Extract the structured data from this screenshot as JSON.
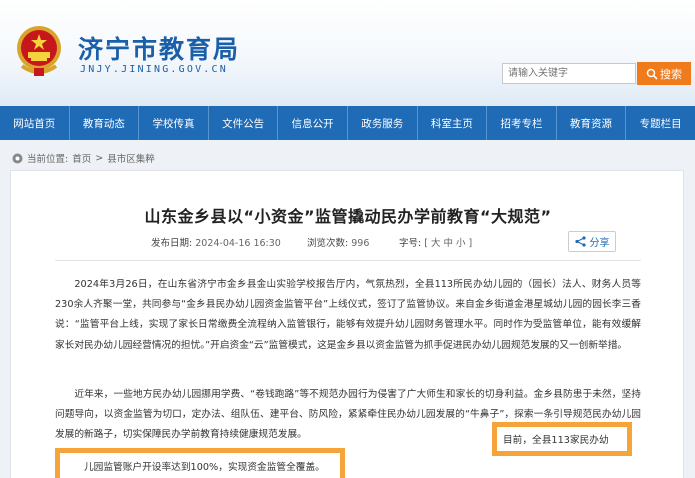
{
  "header": {
    "site_title": "济宁市教育局",
    "site_url": "JNJY.JINING.GOV.CN",
    "search_placeholder": "请输入关键字",
    "search_button": "搜索"
  },
  "nav": {
    "items": [
      "网站首页",
      "教育动态",
      "学校传真",
      "文件公告",
      "信息公开",
      "政务服务",
      "科室主页",
      "招考专栏",
      "教育资源",
      "专题栏目"
    ]
  },
  "breadcrumb": {
    "prefix": "当前位置:",
    "home": "首页",
    "sep": ">",
    "section": "县市区集粹"
  },
  "article": {
    "title": "山东金乡县以“小资金”监管撬动民办学前教育“大规范”",
    "publish_label": "发布日期:",
    "publish_date": "2024-04-16 16:30",
    "views_label": "浏览次数:",
    "views": "996",
    "font_label": "字号:",
    "font_sizes": "[ 大  中  小 ]",
    "share_label": "分享",
    "paragraph1": "2024年3月26日，在山东省济宁市金乡县金山实验学校报告厅内，气氛热烈，全县113所民办幼儿园的（园长）法人、财务人员等230余人齐聚一堂，共同参与“金乡县民办幼儿园资金监管平台”上线仪式，签订了监管协议。来自金乡街道金港星城幼儿园的园长李三香说：“监管平台上线，实现了家长日常缴费全流程纳入监管银行，能够有效提升幼儿园财务管理水平。同时作为受监管单位，能有效缓解家长对民办幼儿园经营情况的担忧。”开启资金“云”监管模式，这是金乡县以资金监管为抓手促进民办幼儿园规范发展的又一创新举措。",
    "paragraph2": "近年来，一些地方民办幼儿园挪用学费、“卷钱跑路”等不规范办园行为侵害了广大师生和家长的切身利益。金乡县防患于未然，坚持问题导向，以资金监管为切口，定办法、组队伍、建平台、防风险，紧紧牵住民办幼儿园发展的“牛鼻子”，探索一条引导规范民办幼儿园发展的新路子，切实保障民办学前教育持续健康规范发展。",
    "highlight1": "目前，全县113家民办幼",
    "highlight2": "儿园监管账户开设率达到100%，实现资金监管全覆盖。"
  },
  "colors": {
    "brand_blue": "#1f6bb6",
    "search_orange": "#f07b1d",
    "highlight_orange": "#f6a33a"
  },
  "icons": {
    "emblem": "national-emblem-icon",
    "search": "search-icon",
    "location": "location-icon",
    "share": "share-icon"
  }
}
